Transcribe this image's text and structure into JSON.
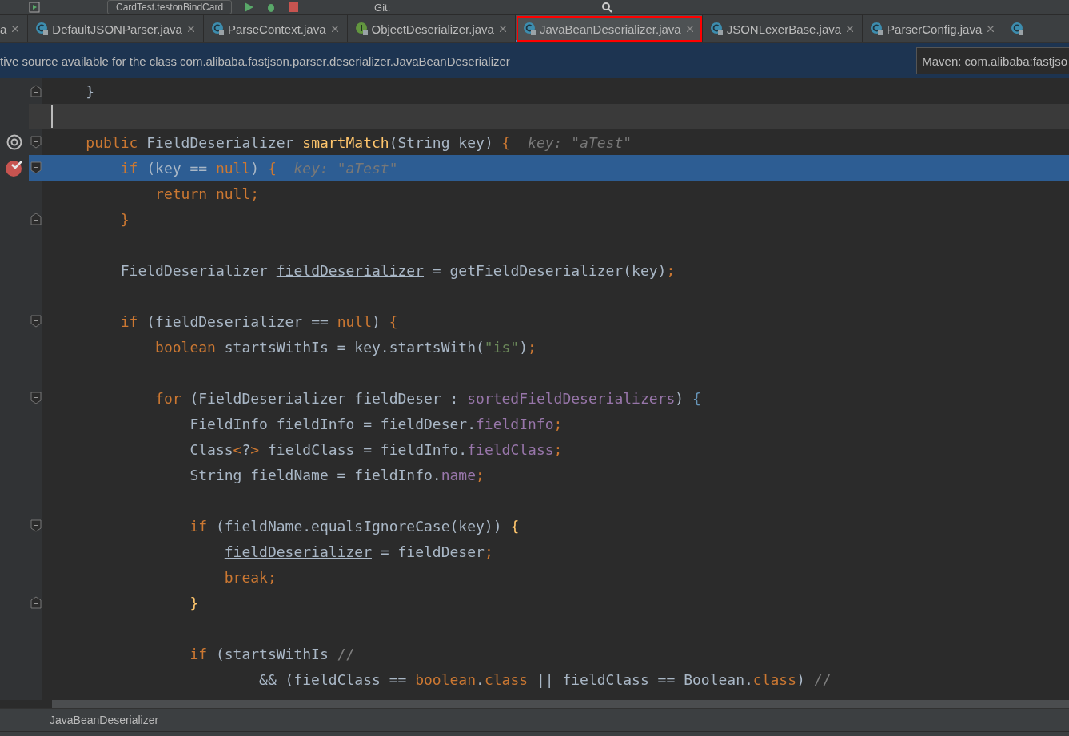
{
  "toolbar": {
    "run_config": "CardTest.testonBindCard",
    "vcs_label": "Git:"
  },
  "tabs": [
    {
      "label": "a",
      "selected": false,
      "outlined": false
    },
    {
      "label": "DefaultJSONParser.java",
      "kind": "class",
      "selected": false,
      "outlined": false
    },
    {
      "label": "ParseContext.java",
      "kind": "class",
      "selected": false,
      "outlined": false
    },
    {
      "label": "ObjectDeserializer.java",
      "kind": "interface",
      "selected": false,
      "outlined": false
    },
    {
      "label": "JavaBeanDeserializer.java",
      "kind": "class",
      "selected": true,
      "outlined": true
    },
    {
      "label": "JSONLexerBase.java",
      "kind": "class",
      "selected": false,
      "outlined": false
    },
    {
      "label": "ParserConfig.java",
      "kind": "class",
      "selected": false,
      "outlined": false
    },
    {
      "kind": "class",
      "selected": false,
      "outlined": false
    }
  ],
  "notice": {
    "text": "tive source available for the class com.alibaba.fastjson.parser.deserializer.JavaBeanDeserializer",
    "button": "Maven: com.alibaba:fastjso"
  },
  "code_lines": [
    {
      "fold": {
        "kind": "close"
      },
      "highlighted": false,
      "tokens": [
        {
          "text": "    }",
          "kind": "plain"
        }
      ]
    },
    {
      "highlighted": false,
      "caret": true
    },
    {
      "marker": {
        "kind": "override"
      },
      "fold": {
        "kind": "open"
      },
      "highlighted": false,
      "tokens": [
        {
          "text": "    public ",
          "kind": "kw"
        },
        {
          "text": "FieldDeserializer ",
          "kind": "plain"
        },
        {
          "text": "smartMatch",
          "kind": "method"
        },
        {
          "text": "(String key) ",
          "kind": "plain"
        },
        {
          "text": "{",
          "kind": "kw"
        },
        {
          "text": "  key: \"aTest\"",
          "kind": "hint"
        }
      ]
    },
    {
      "marker": {
        "kind": "breakpoint"
      },
      "fold": {
        "kind": "open"
      },
      "highlighted": true,
      "tokens": [
        {
          "text": "        if ",
          "kind": "kw"
        },
        {
          "text": "(key == ",
          "kind": "plain"
        },
        {
          "text": "null",
          "kind": "kw"
        },
        {
          "text": ") ",
          "kind": "plain"
        },
        {
          "text": "{",
          "kind": "kw"
        },
        {
          "text": "  key: \"aTest\"",
          "kind": "hint"
        }
      ]
    },
    {
      "highlighted": false,
      "tokens": [
        {
          "text": "            return null;",
          "kind": "kw"
        }
      ]
    },
    {
      "fold": {
        "kind": "close"
      },
      "highlighted": false,
      "tokens": [
        {
          "text": "        }",
          "kind": "kw"
        }
      ]
    },
    {
      "highlighted": false
    },
    {
      "highlighted": false,
      "tokens": [
        {
          "text": "        FieldDeserializer ",
          "kind": "plain"
        },
        {
          "text": "fieldDeserializer",
          "kind": "underlined"
        },
        {
          "text": " = getFieldDeserializer(key)",
          "kind": "plain"
        },
        {
          "text": ";",
          "kind": "kw"
        }
      ]
    },
    {
      "highlighted": false
    },
    {
      "fold": {
        "kind": "open"
      },
      "highlighted": false,
      "tokens": [
        {
          "text": "        if ",
          "kind": "kw"
        },
        {
          "text": "(",
          "kind": "plain"
        },
        {
          "text": "fieldDeserializer",
          "kind": "underlined"
        },
        {
          "text": " == ",
          "kind": "plain"
        },
        {
          "text": "null",
          "kind": "kw"
        },
        {
          "text": ") ",
          "kind": "plain"
        },
        {
          "text": "{",
          "kind": "kw"
        }
      ]
    },
    {
      "highlighted": false,
      "tokens": [
        {
          "text": "            boolean ",
          "kind": "kw"
        },
        {
          "text": "startsWithIs = key.startsWith(",
          "kind": "plain"
        },
        {
          "text": "\"is\"",
          "kind": "str"
        },
        {
          "text": ")",
          "kind": "plain"
        },
        {
          "text": ";",
          "kind": "kw"
        }
      ]
    },
    {
      "highlighted": false
    },
    {
      "fold": {
        "kind": "open"
      },
      "highlighted": false,
      "tokens": [
        {
          "text": "            for ",
          "kind": "kw"
        },
        {
          "text": "(FieldDeserializer fieldDeser : ",
          "kind": "plain"
        },
        {
          "text": "sortedFieldDeserializers",
          "kind": "field"
        },
        {
          "text": ") ",
          "kind": "plain"
        },
        {
          "text": "{",
          "kind": "brace"
        }
      ]
    },
    {
      "highlighted": false,
      "tokens": [
        {
          "text": "                FieldInfo fieldInfo = fieldDeser.",
          "kind": "plain"
        },
        {
          "text": "fieldInfo",
          "kind": "field"
        },
        {
          "text": ";",
          "kind": "kw"
        }
      ]
    },
    {
      "highlighted": false,
      "tokens": [
        {
          "text": "                Class",
          "kind": "plain"
        },
        {
          "text": "<",
          "kind": "kw"
        },
        {
          "text": "?",
          "kind": "plain"
        },
        {
          "text": ">",
          "kind": "kw"
        },
        {
          "text": " fieldClass = fieldInfo.",
          "kind": "plain"
        },
        {
          "text": "fieldClass",
          "kind": "field"
        },
        {
          "text": ";",
          "kind": "kw"
        }
      ]
    },
    {
      "highlighted": false,
      "tokens": [
        {
          "text": "                String fieldName = fieldInfo.",
          "kind": "plain"
        },
        {
          "text": "name",
          "kind": "field"
        },
        {
          "text": ";",
          "kind": "kw"
        }
      ]
    },
    {
      "highlighted": false
    },
    {
      "fold": {
        "kind": "open"
      },
      "highlighted": false,
      "tokens": [
        {
          "text": "                if ",
          "kind": "kw"
        },
        {
          "text": "(fieldName.equalsIgnoreCase(key)) ",
          "kind": "plain"
        },
        {
          "text": "{",
          "kind": "method"
        }
      ]
    },
    {
      "highlighted": false,
      "tokens": [
        {
          "text": "                    fieldDeserializer",
          "kind": "underlined"
        },
        {
          "text": " = fieldDeser",
          "kind": "plain"
        },
        {
          "text": ";",
          "kind": "kw"
        }
      ]
    },
    {
      "highlighted": false,
      "tokens": [
        {
          "text": "                    break;",
          "kind": "kw"
        }
      ]
    },
    {
      "fold": {
        "kind": "close"
      },
      "highlighted": false,
      "tokens": [
        {
          "text": "                }",
          "kind": "method"
        }
      ]
    },
    {
      "highlighted": false
    },
    {
      "highlighted": false,
      "tokens": [
        {
          "text": "                if ",
          "kind": "kw"
        },
        {
          "text": "(startsWithIs ",
          "kind": "plain"
        },
        {
          "text": "//",
          "kind": "comment"
        }
      ]
    },
    {
      "highlighted": false,
      "tokens": [
        {
          "text": "                        && (fieldClass == ",
          "kind": "plain"
        },
        {
          "text": "boolean",
          "kind": "kw"
        },
        {
          "text": ".",
          "kind": "plain"
        },
        {
          "text": "class",
          "kind": "kw"
        },
        {
          "text": " || fieldClass == Boolean.",
          "kind": "plain"
        },
        {
          "text": "class",
          "kind": "kw"
        },
        {
          "text": ") ",
          "kind": "plain"
        },
        {
          "text": "//",
          "kind": "comment"
        }
      ]
    }
  ],
  "breadcrumb": "JavaBeanDeserializer"
}
